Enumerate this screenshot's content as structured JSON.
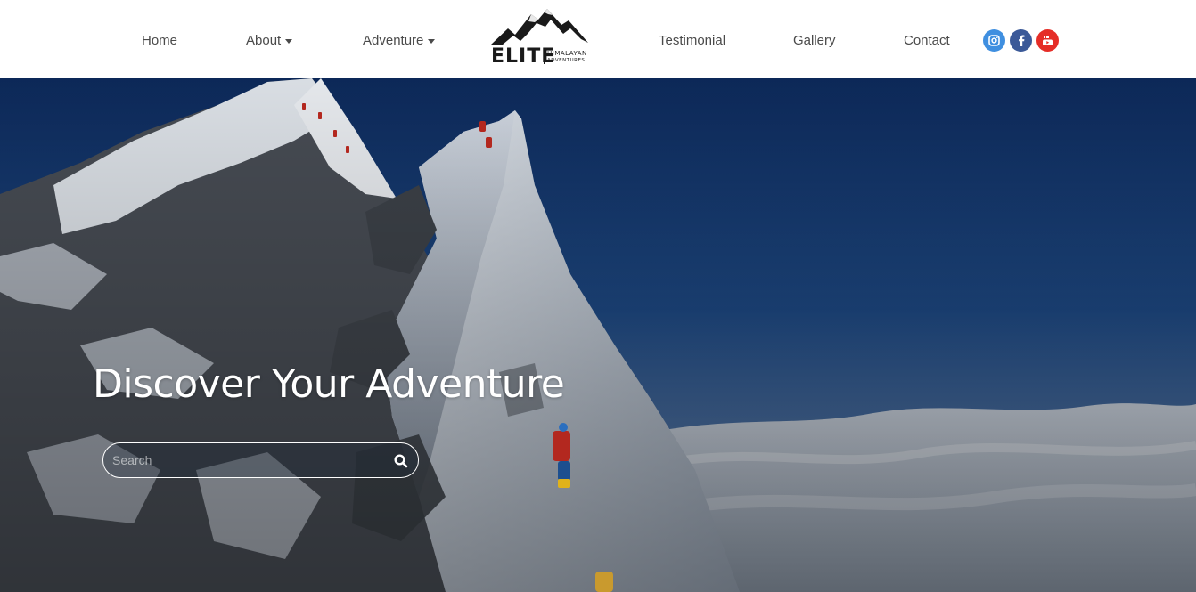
{
  "nav": {
    "items": [
      {
        "label": "Home"
      },
      {
        "label": "About",
        "has_dropdown": true
      },
      {
        "label": "Adventure",
        "has_dropdown": true
      },
      {
        "label": "Testimonial"
      },
      {
        "label": "Gallery"
      },
      {
        "label": "Contact"
      }
    ]
  },
  "logo": {
    "wordmark": "ELITE",
    "line1": "HIMALAYAN",
    "line2": "ADVENTURES"
  },
  "social": [
    {
      "icon": "instagram-icon",
      "color": "#3f8fe0"
    },
    {
      "icon": "facebook-icon",
      "color": "#3b5998"
    },
    {
      "icon": "youtube-icon",
      "color": "#e52d27"
    }
  ],
  "hero": {
    "title": "Discover Your Adventure",
    "search_placeholder": "Search",
    "search_value": ""
  },
  "colors": {
    "nav_text": "#4a4a4a",
    "navbar_bg": "#ffffff",
    "hero_text": "#ffffff"
  }
}
